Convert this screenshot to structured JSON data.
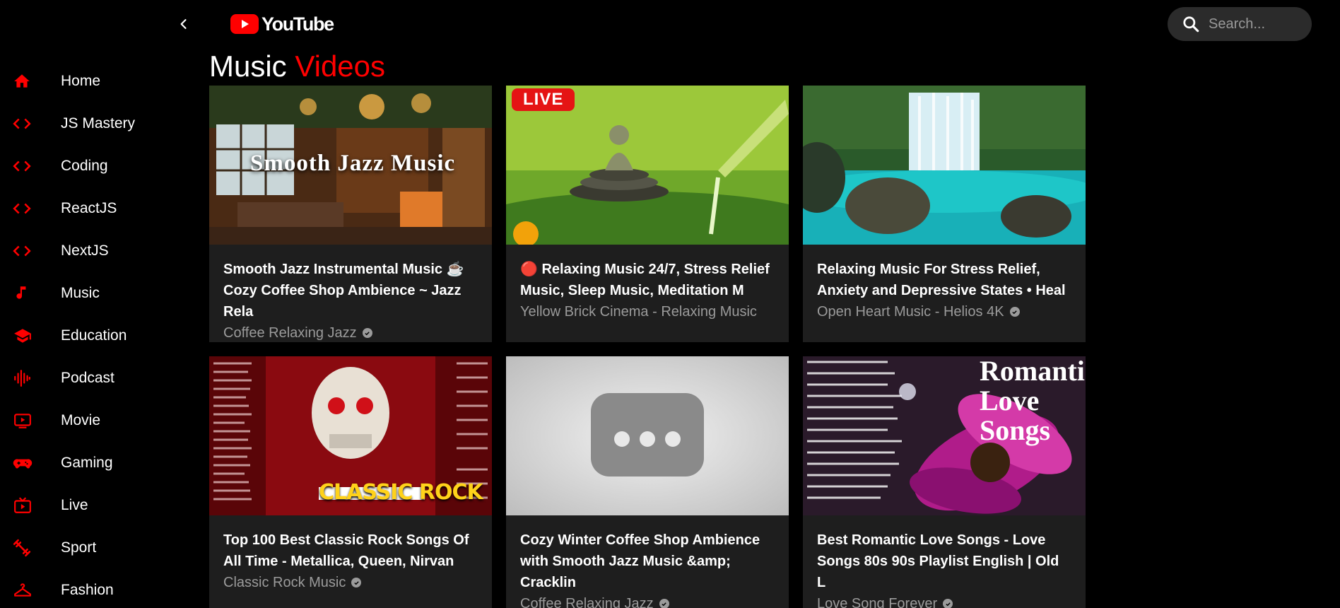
{
  "header": {
    "logo_text": "YouTube",
    "search_placeholder": "Search..."
  },
  "sidebar": {
    "items": [
      {
        "label": "Home",
        "icon": "home-icon"
      },
      {
        "label": "JS Mastery",
        "icon": "code-icon"
      },
      {
        "label": "Coding",
        "icon": "code-icon"
      },
      {
        "label": "ReactJS",
        "icon": "code-icon"
      },
      {
        "label": "NextJS",
        "icon": "code-icon"
      },
      {
        "label": "Music",
        "icon": "music-note-icon"
      },
      {
        "label": "Education",
        "icon": "graduation-cap-icon"
      },
      {
        "label": "Podcast",
        "icon": "soundwave-icon"
      },
      {
        "label": "Movie",
        "icon": "play-screen-icon"
      },
      {
        "label": "Gaming",
        "icon": "gamepad-icon"
      },
      {
        "label": "Live",
        "icon": "live-tv-icon"
      },
      {
        "label": "Sport",
        "icon": "fitness-icon"
      },
      {
        "label": "Fashion",
        "icon": "hanger-icon"
      }
    ]
  },
  "main": {
    "title_part1": "Music",
    "title_part2": "Videos"
  },
  "videos": [
    {
      "title": "Smooth Jazz Instrumental Music ☕ Cozy Coffee Shop Ambience ~ Jazz Rela",
      "channel": "Coffee Relaxing Jazz",
      "thumb_text": "Smooth Jazz Music"
    },
    {
      "title": "🔴 Relaxing Music 24/7, Stress Relief Music, Sleep Music, Meditation M",
      "channel": "Yellow Brick Cinema - Relaxing Music",
      "badge": "LIVE"
    },
    {
      "title": "Relaxing Music For Stress Relief, Anxiety and Depressive States • Heal",
      "channel": "Open Heart Music - Helios 4K"
    },
    {
      "title": "Top 100 Best Classic Rock Songs Of All Time - Metallica, Queen, Nirvan",
      "channel": "Classic Rock Music",
      "thumb_text": "CLASSIC ROCK"
    },
    {
      "title": "Cozy Winter Coffee Shop Ambience with Smooth Jazz Music &amp; Cracklin",
      "channel": "Coffee Relaxing Jazz"
    },
    {
      "title": "Best Romantic Love Songs - Love Songs 80s 90s Playlist English | Old L",
      "channel": "Love Song Forever",
      "thumb_text": "Romantic Love Songs"
    }
  ],
  "colors": {
    "accent": "#ff0000",
    "background": "#000000",
    "card": "#1e1e1e",
    "muted_text": "#9b9b9b"
  }
}
